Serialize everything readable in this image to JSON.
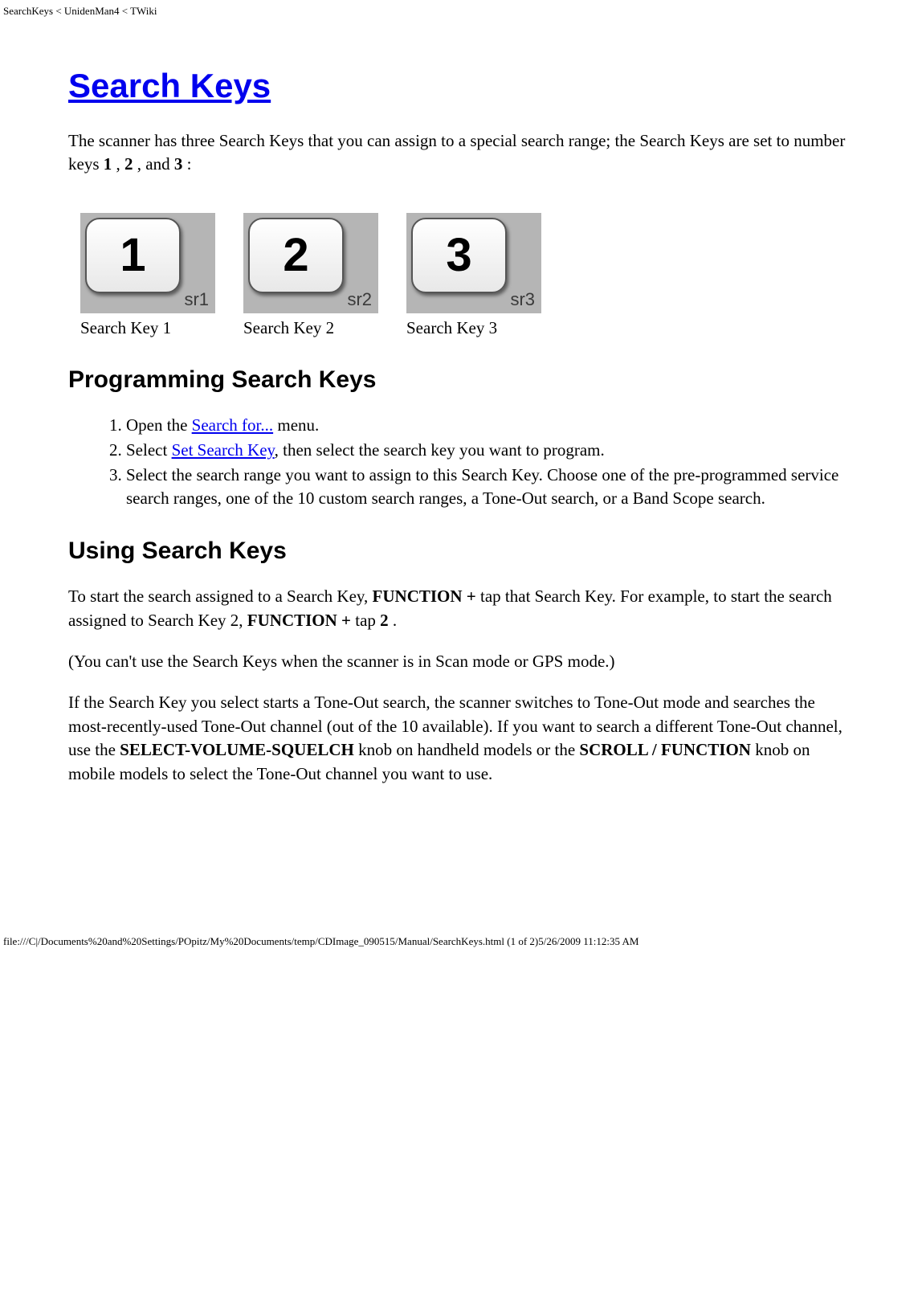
{
  "header": {
    "path": "SearchKeys < UnidenMan4 < TWiki"
  },
  "page": {
    "title": "Search Keys",
    "intro_prefix": "The scanner has three Search Keys that you can assign to a special search range; the Search Keys are set to number keys ",
    "intro_bold_1": "1",
    "intro_mid_1": " , ",
    "intro_bold_2": "2",
    "intro_mid_2": " , and ",
    "intro_bold_3": "3",
    "intro_suffix": " :"
  },
  "keys": {
    "k1": {
      "num": "1",
      "sr": "sr1",
      "caption": "Search Key 1"
    },
    "k2": {
      "num": "2",
      "sr": "sr2",
      "caption": "Search Key 2"
    },
    "k3": {
      "num": "3",
      "sr": "sr3",
      "caption": "Search Key 3"
    }
  },
  "h2_programming": "Programming Search Keys",
  "steps": {
    "s1_pre": "Open the ",
    "s1_link": "Search for...",
    "s1_post": " menu.",
    "s2_pre": "Select ",
    "s2_link": "Set Search Key",
    "s2_post": ", then select the search key you want to program.",
    "s3": "Select the search range you want to assign to this Search Key. Choose one of the pre-programmed service search ranges, one of the 10 custom search ranges, a Tone-Out search, or a Band Scope search."
  },
  "h2_using": "Using Search Keys",
  "using": {
    "p1_pre": "To start the search assigned to a Search Key, ",
    "p1_b1": "FUNCTION +",
    "p1_mid": " tap that Search Key. For example, to start the search assigned to Search Key 2, ",
    "p1_b2": "FUNCTION +",
    "p1_mid2": " tap ",
    "p1_b3": "2",
    "p1_end": " .",
    "p2": "(You can't use the Search Keys when the scanner is in Scan mode or GPS mode.)",
    "p3_pre": "If the Search Key you select starts a Tone-Out search, the scanner switches to Tone-Out mode and searches the most-recently-used Tone-Out channel (out of the 10 available). If you want to search a different Tone-Out channel, use the ",
    "p3_b1": "SELECT-VOLUME-SQUELCH",
    "p3_mid": " knob on handheld models or the ",
    "p3_b2": "SCROLL / FUNCTION",
    "p3_end": " knob on mobile models to select the Tone-Out channel you want to use."
  },
  "footer": {
    "path": "file:///C|/Documents%20and%20Settings/POpitz/My%20Documents/temp/CDImage_090515/Manual/SearchKeys.html (1 of 2)5/26/2009 11:12:35 AM"
  }
}
